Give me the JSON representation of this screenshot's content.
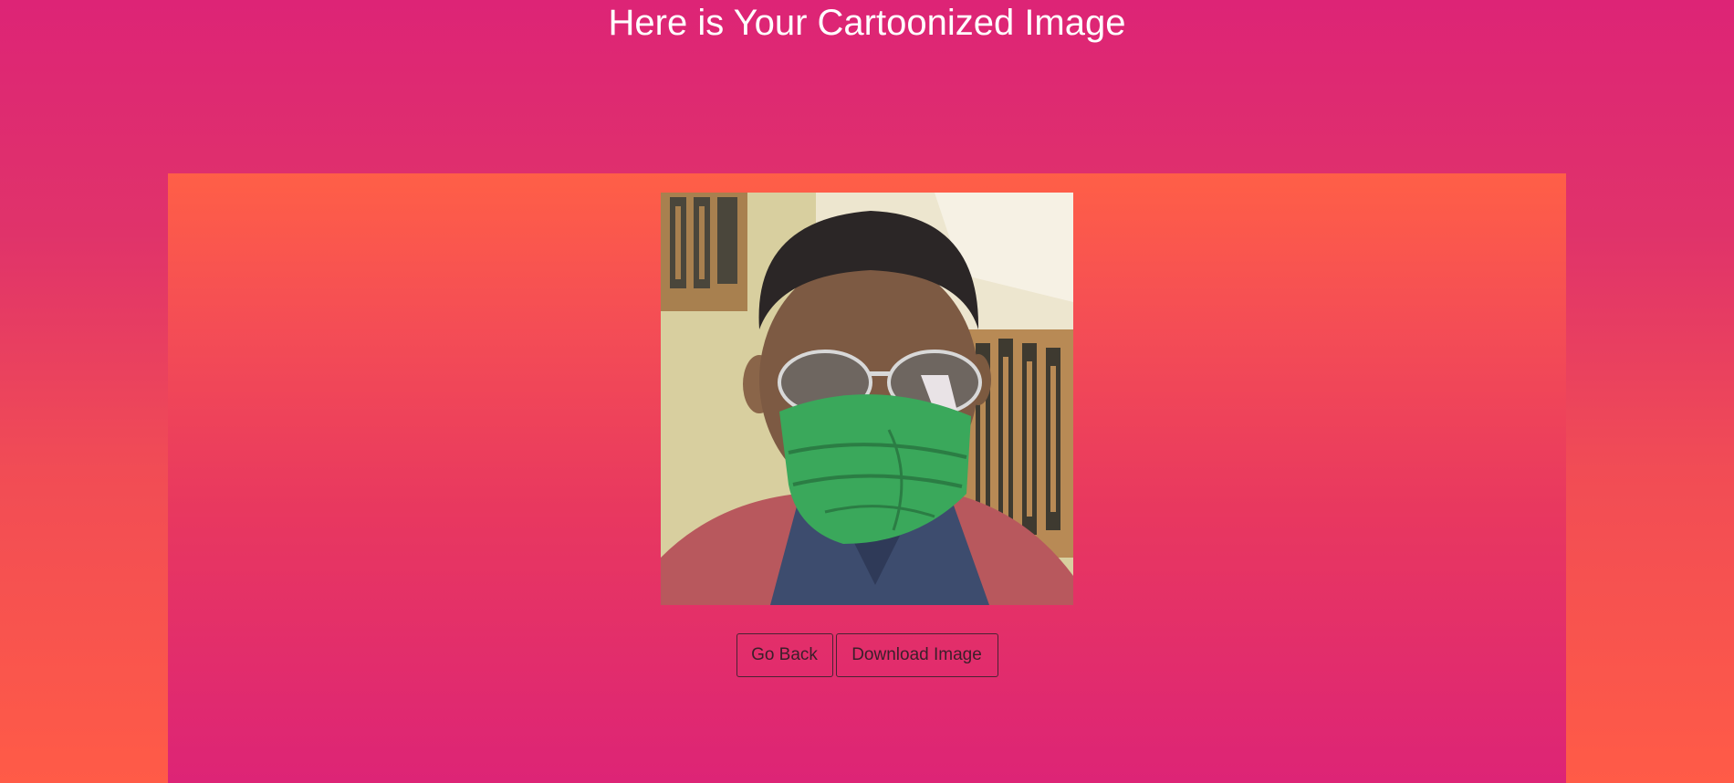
{
  "page": {
    "title": "Here is Your Cartoonized Image"
  },
  "result": {
    "image_icon": "cartoonized-photo"
  },
  "actions": {
    "back_label": "Go Back",
    "download_label": "Download Image"
  },
  "colors": {
    "background_top": "#dd2476",
    "background_bottom": "#ff5b47",
    "title_text": "#ffffff",
    "button_border": "#4a2233"
  }
}
